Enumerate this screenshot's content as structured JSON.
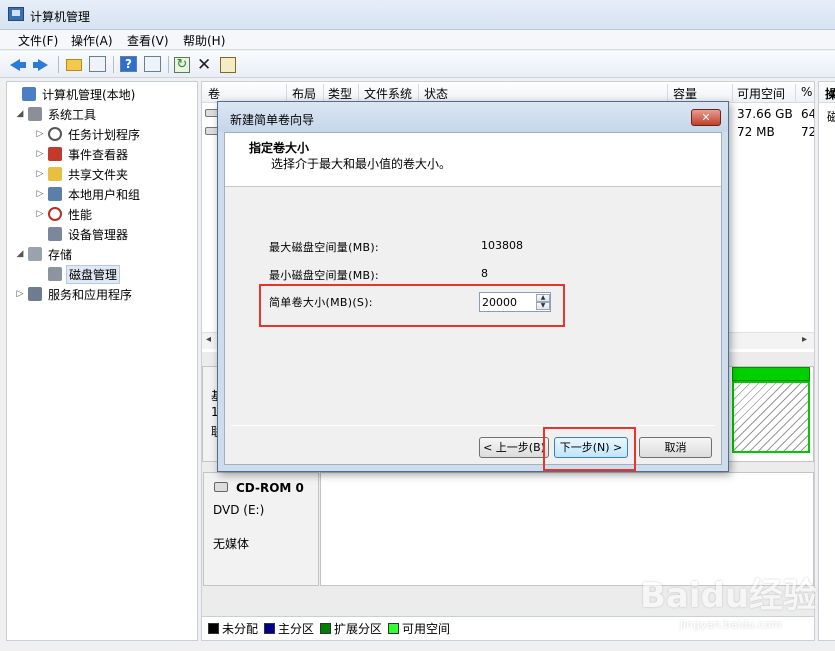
{
  "window": {
    "title": "计算机管理"
  },
  "menu": [
    "文件(F)",
    "操作(A)",
    "查看(V)",
    "帮助(H)"
  ],
  "tree": {
    "root": "计算机管理(本地)",
    "system_tools": "系统工具",
    "task_scheduler": "任务计划程序",
    "event_viewer": "事件查看器",
    "shared_folders": "共享文件夹",
    "local_users": "本地用户和组",
    "performance": "性能",
    "device_manager": "设备管理器",
    "storage": "存储",
    "disk_management": "磁盘管理",
    "services_apps": "服务和应用程序"
  },
  "volume_table": {
    "columns": [
      "卷",
      "布局",
      "类型",
      "文件系统",
      "状态",
      "容量",
      "可用空间",
      "%"
    ],
    "rows": [
      {
        "free": "37.66 GB",
        "pct": "64"
      },
      {
        "free": "72 MB",
        "pct": "72"
      }
    ]
  },
  "disk_panel": {
    "disk0_fragments": [
      "基",
      "1",
      "联"
    ],
    "cdrom_name": "CD-ROM 0",
    "cdrom_type": "DVD (E:)",
    "cdrom_media": "无媒体"
  },
  "legend": [
    {
      "label": "未分配",
      "color": "#000000"
    },
    {
      "label": "主分区",
      "color": "#00008b"
    },
    {
      "label": "扩展分区",
      "color": "#008000"
    },
    {
      "label": "可用空间",
      "color": "#33ff33"
    }
  ],
  "action_pane": {
    "header": "操",
    "row": "磁"
  },
  "wizard": {
    "title": "新建简单卷向导",
    "close_label": "✕",
    "heading": "指定卷大小",
    "description": "选择介于最大和最小值的卷大小。",
    "max_label": "最大磁盘空间量(MB):",
    "max_value": "103808",
    "min_label": "最小磁盘空间量(MB):",
    "min_value": "8",
    "size_label": "简单卷大小(MB)(S):",
    "size_value": "20000",
    "back_button": "< 上一步(B)",
    "next_button": "下一步(N) >",
    "cancel_button": "取消"
  },
  "watermark": {
    "brand": "Baidu经验",
    "url": "jingyan.baidu.com"
  }
}
